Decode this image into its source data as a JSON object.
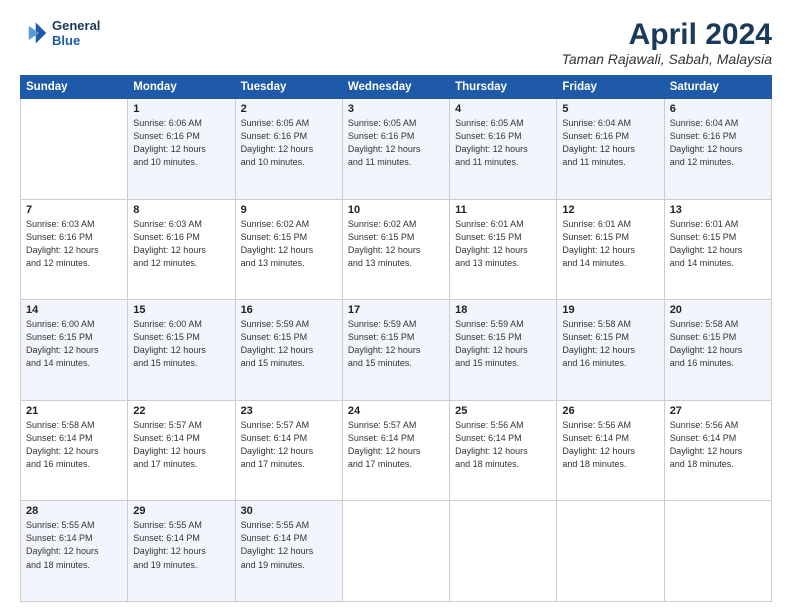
{
  "logo": {
    "line1": "General",
    "line2": "Blue"
  },
  "title": "April 2024",
  "subtitle": "Taman Rajawali, Sabah, Malaysia",
  "header_days": [
    "Sunday",
    "Monday",
    "Tuesday",
    "Wednesday",
    "Thursday",
    "Friday",
    "Saturday"
  ],
  "weeks": [
    [
      {
        "num": "",
        "info": ""
      },
      {
        "num": "1",
        "info": "Sunrise: 6:06 AM\nSunset: 6:16 PM\nDaylight: 12 hours\nand 10 minutes."
      },
      {
        "num": "2",
        "info": "Sunrise: 6:05 AM\nSunset: 6:16 PM\nDaylight: 12 hours\nand 10 minutes."
      },
      {
        "num": "3",
        "info": "Sunrise: 6:05 AM\nSunset: 6:16 PM\nDaylight: 12 hours\nand 11 minutes."
      },
      {
        "num": "4",
        "info": "Sunrise: 6:05 AM\nSunset: 6:16 PM\nDaylight: 12 hours\nand 11 minutes."
      },
      {
        "num": "5",
        "info": "Sunrise: 6:04 AM\nSunset: 6:16 PM\nDaylight: 12 hours\nand 11 minutes."
      },
      {
        "num": "6",
        "info": "Sunrise: 6:04 AM\nSunset: 6:16 PM\nDaylight: 12 hours\nand 12 minutes."
      }
    ],
    [
      {
        "num": "7",
        "info": "Sunrise: 6:03 AM\nSunset: 6:16 PM\nDaylight: 12 hours\nand 12 minutes."
      },
      {
        "num": "8",
        "info": "Sunrise: 6:03 AM\nSunset: 6:16 PM\nDaylight: 12 hours\nand 12 minutes."
      },
      {
        "num": "9",
        "info": "Sunrise: 6:02 AM\nSunset: 6:15 PM\nDaylight: 12 hours\nand 13 minutes."
      },
      {
        "num": "10",
        "info": "Sunrise: 6:02 AM\nSunset: 6:15 PM\nDaylight: 12 hours\nand 13 minutes."
      },
      {
        "num": "11",
        "info": "Sunrise: 6:01 AM\nSunset: 6:15 PM\nDaylight: 12 hours\nand 13 minutes."
      },
      {
        "num": "12",
        "info": "Sunrise: 6:01 AM\nSunset: 6:15 PM\nDaylight: 12 hours\nand 14 minutes."
      },
      {
        "num": "13",
        "info": "Sunrise: 6:01 AM\nSunset: 6:15 PM\nDaylight: 12 hours\nand 14 minutes."
      }
    ],
    [
      {
        "num": "14",
        "info": "Sunrise: 6:00 AM\nSunset: 6:15 PM\nDaylight: 12 hours\nand 14 minutes."
      },
      {
        "num": "15",
        "info": "Sunrise: 6:00 AM\nSunset: 6:15 PM\nDaylight: 12 hours\nand 15 minutes."
      },
      {
        "num": "16",
        "info": "Sunrise: 5:59 AM\nSunset: 6:15 PM\nDaylight: 12 hours\nand 15 minutes."
      },
      {
        "num": "17",
        "info": "Sunrise: 5:59 AM\nSunset: 6:15 PM\nDaylight: 12 hours\nand 15 minutes."
      },
      {
        "num": "18",
        "info": "Sunrise: 5:59 AM\nSunset: 6:15 PM\nDaylight: 12 hours\nand 15 minutes."
      },
      {
        "num": "19",
        "info": "Sunrise: 5:58 AM\nSunset: 6:15 PM\nDaylight: 12 hours\nand 16 minutes."
      },
      {
        "num": "20",
        "info": "Sunrise: 5:58 AM\nSunset: 6:15 PM\nDaylight: 12 hours\nand 16 minutes."
      }
    ],
    [
      {
        "num": "21",
        "info": "Sunrise: 5:58 AM\nSunset: 6:14 PM\nDaylight: 12 hours\nand 16 minutes."
      },
      {
        "num": "22",
        "info": "Sunrise: 5:57 AM\nSunset: 6:14 PM\nDaylight: 12 hours\nand 17 minutes."
      },
      {
        "num": "23",
        "info": "Sunrise: 5:57 AM\nSunset: 6:14 PM\nDaylight: 12 hours\nand 17 minutes."
      },
      {
        "num": "24",
        "info": "Sunrise: 5:57 AM\nSunset: 6:14 PM\nDaylight: 12 hours\nand 17 minutes."
      },
      {
        "num": "25",
        "info": "Sunrise: 5:56 AM\nSunset: 6:14 PM\nDaylight: 12 hours\nand 18 minutes."
      },
      {
        "num": "26",
        "info": "Sunrise: 5:56 AM\nSunset: 6:14 PM\nDaylight: 12 hours\nand 18 minutes."
      },
      {
        "num": "27",
        "info": "Sunrise: 5:56 AM\nSunset: 6:14 PM\nDaylight: 12 hours\nand 18 minutes."
      }
    ],
    [
      {
        "num": "28",
        "info": "Sunrise: 5:55 AM\nSunset: 6:14 PM\nDaylight: 12 hours\nand 18 minutes."
      },
      {
        "num": "29",
        "info": "Sunrise: 5:55 AM\nSunset: 6:14 PM\nDaylight: 12 hours\nand 19 minutes."
      },
      {
        "num": "30",
        "info": "Sunrise: 5:55 AM\nSunset: 6:14 PM\nDaylight: 12 hours\nand 19 minutes."
      },
      {
        "num": "",
        "info": ""
      },
      {
        "num": "",
        "info": ""
      },
      {
        "num": "",
        "info": ""
      },
      {
        "num": "",
        "info": ""
      }
    ]
  ]
}
